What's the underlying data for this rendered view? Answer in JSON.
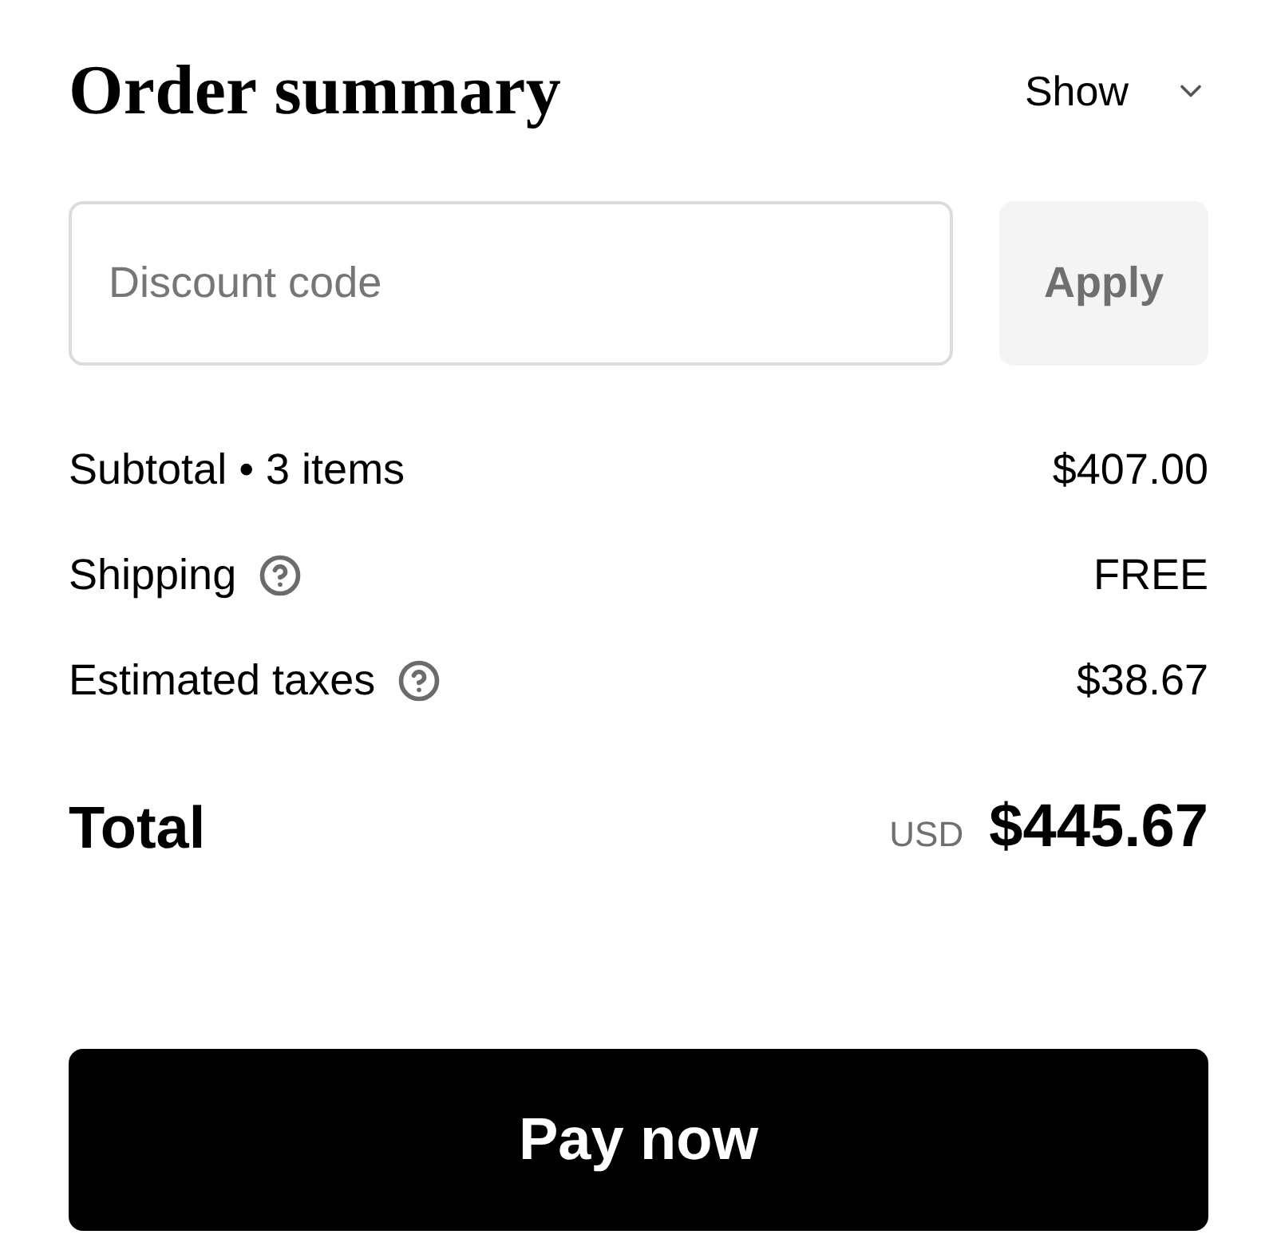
{
  "title": "Order summary",
  "toggle": {
    "label": "Show",
    "expanded": false
  },
  "discount": {
    "placeholder": "Discount code",
    "button": "Apply"
  },
  "lines": [
    {
      "label": "Subtotal • 3 items",
      "info": false,
      "value": "$407.00"
    },
    {
      "label": "Shipping",
      "info": true,
      "value": "FREE"
    },
    {
      "label": "Estimated taxes",
      "info": true,
      "value": "$38.67"
    }
  ],
  "total": {
    "label": "Total",
    "currency": "USD",
    "amount": "$445.67"
  },
  "pay_button": "Pay now"
}
